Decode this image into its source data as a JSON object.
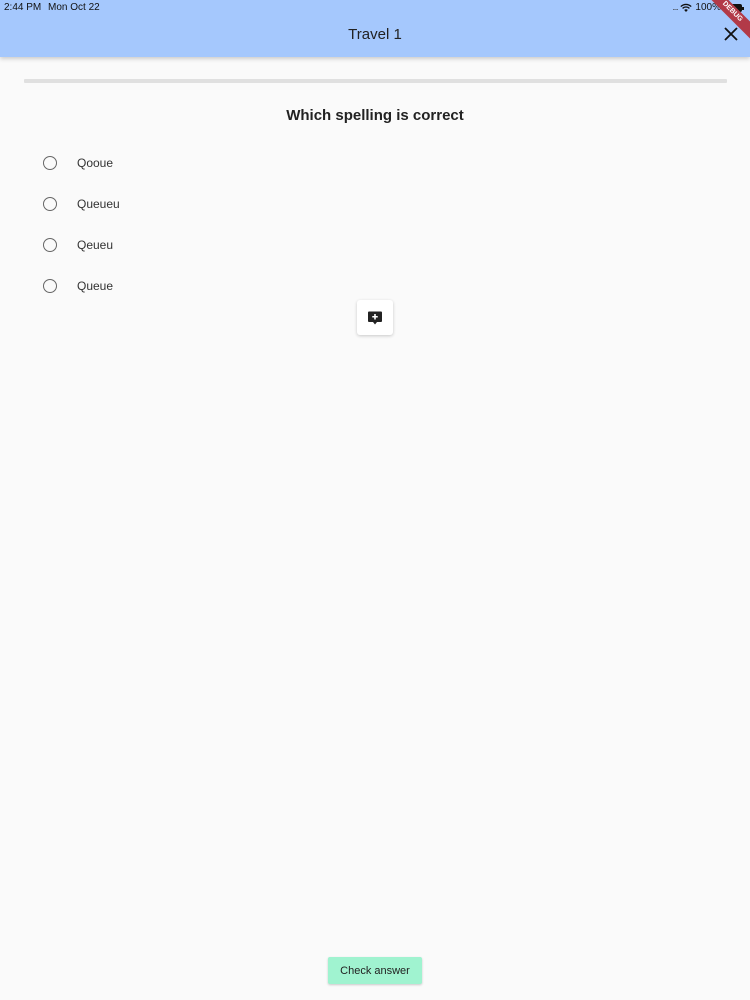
{
  "status_bar": {
    "time": "2:44 PM",
    "date": "Mon Oct 22",
    "battery": "100%"
  },
  "app_bar": {
    "title": "Travel 1",
    "close_icon": "close-icon",
    "debug_label": "DEBUG"
  },
  "progress": {
    "value": 0
  },
  "quiz": {
    "question": "Which spelling is correct",
    "options": [
      {
        "label": "Qooue",
        "selected": false
      },
      {
        "label": "Queueu",
        "selected": false
      },
      {
        "label": "Qeueu",
        "selected": false
      },
      {
        "label": "Queue",
        "selected": false
      }
    ],
    "hint_icon": "add-comment-icon"
  },
  "actions": {
    "check_label": "Check answer"
  },
  "colors": {
    "app_bar": "#a5c8fd",
    "background": "#fafafa",
    "check_button": "#a0f3d0",
    "debug_ribbon": "#b23a48"
  }
}
